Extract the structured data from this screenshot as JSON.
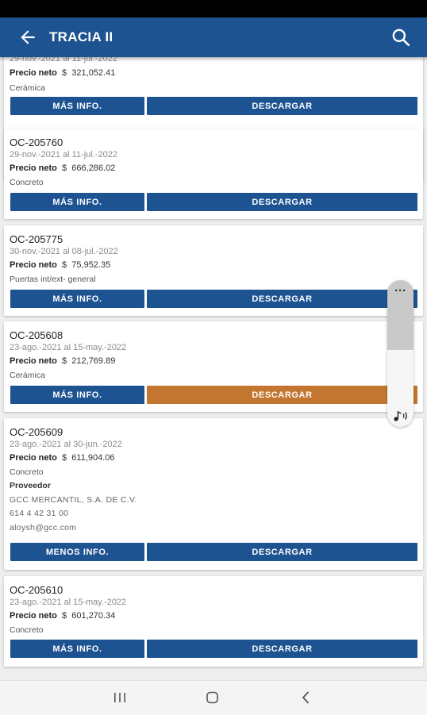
{
  "app_bar": {
    "title": "TRACIA II",
    "back_icon": "arrow-left-icon",
    "search_icon": "search-icon"
  },
  "labels": {
    "precio_neto": "Precio neto",
    "currency": "$",
    "mas_info": "MÁS INFO.",
    "menos_info": "MENOS INFO.",
    "descargar": "DESCARGAR",
    "proveedor": "Proveedor"
  },
  "cards": [
    {
      "oc": "",
      "dates": "29-nov.-2021 al 11-jul.-2022",
      "price": "321,052.41",
      "category": "Cerámica"
    },
    {
      "oc": "OC-205760",
      "dates": "29-nov.-2021 al 11-jul.-2022",
      "price": "666,286.02",
      "category": "Concreto"
    },
    {
      "oc": "OC-205775",
      "dates": "30-nov.-2021 al 08-jul.-2022",
      "price": "75,952.35",
      "category": "Puertas int/ext- general"
    },
    {
      "oc": "OC-205608",
      "dates": "23-ago.-2021 al 15-may.-2022",
      "price": "212,769.89",
      "category": "Cerámica"
    },
    {
      "oc": "OC-205609",
      "dates": "23-ago.-2021 al 30-jun.-2022",
      "price": "611,904.06",
      "category": "Concreto",
      "provider": {
        "name": "GCC MERCANTIL, S.A. DE C.V.",
        "phone": "614 4 42 31 00",
        "email": "aloysh@gcc.com"
      }
    },
    {
      "oc": "OC-205610",
      "dates": "23-ago.-2021 al 15-may.-2022",
      "price": "601,270.34",
      "category": "Concreto"
    }
  ],
  "floating_widget": {
    "menu_icon": "more-horizontal-icon",
    "menu_glyph": "···",
    "audio_icon": "audio-note-icon"
  },
  "nav_bar": {
    "recents_icon": "recents-icon",
    "home_icon": "home-icon",
    "back_icon": "nav-back-icon"
  },
  "colors": {
    "primary": "#1e5391",
    "accent_orange": "#c2762f",
    "background": "#eeeeee"
  }
}
